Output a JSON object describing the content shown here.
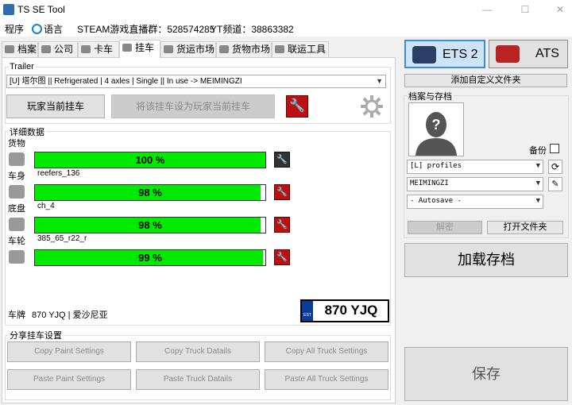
{
  "window": {
    "title": "TS SE Tool",
    "min": "—",
    "max": "☐",
    "close": "✕"
  },
  "menu": {
    "program": "程序",
    "language": "语言",
    "steam_group": "STEAM游戏直播群：528574285",
    "wechat": "YT频道：38863382"
  },
  "tabs": [
    {
      "label": "档案"
    },
    {
      "label": "公司"
    },
    {
      "label": "卡车"
    },
    {
      "label": "挂车"
    },
    {
      "label": "货运市场"
    },
    {
      "label": "货物市场"
    },
    {
      "label": "联运工具"
    }
  ],
  "trailer": {
    "group_label": "Trailer",
    "selected": "[U] 塔尔图 || Refrigerated | 4 axles | Single || In use -> MEIMINGZI",
    "player_trailer_button": "玩家当前挂车",
    "set_player_trailer_button": "将该挂车设为玩家当前挂车"
  },
  "details": {
    "group_label": "详细数据",
    "cargo_label": "货物",
    "parts": [
      {
        "name": "车身",
        "value_label": "100 %",
        "percent": 100,
        "model": "reefers_136",
        "icon": "body-icon"
      },
      {
        "name": "底盘",
        "value_label": "98 %",
        "percent": 98,
        "model": "ch_4",
        "icon": "chassis-icon"
      },
      {
        "name": "车轮",
        "value_label": "98 %",
        "percent": 98,
        "model": "385_65_r22_r",
        "icon": "wheels-icon"
      },
      {
        "name": "",
        "value_label": "99 %",
        "percent": 99,
        "model": "",
        "icon": "tire-icon"
      }
    ],
    "plate_label": "车牌",
    "plate_value": "870 YJQ | 爱沙尼亚",
    "plate_display": "870 YJQ",
    "plate_country": "EST"
  },
  "share": {
    "group_label": "分享挂车设置",
    "buttons": [
      "Copy Paint Settings",
      "Copy Truck Datails",
      "Copy All Truck Settings",
      "Paste Paint Settings",
      "Paste Truck Datails",
      "Paste All Truck Settings"
    ]
  },
  "right": {
    "ets2": "ETS 2",
    "ats": "ATS",
    "add_custom_folder": "添加自定义文件夹",
    "profiles_group_label": "档案与存档",
    "backup_label": "备份",
    "profiles_combo": "[L] profiles",
    "profile_combo": "MEIMINGZI",
    "save_combo": "- Autosave -",
    "decrypt_button": "解密",
    "open_folder_button": "打开文件夹",
    "load_save_button": "加载存档",
    "save_button": "保存"
  }
}
